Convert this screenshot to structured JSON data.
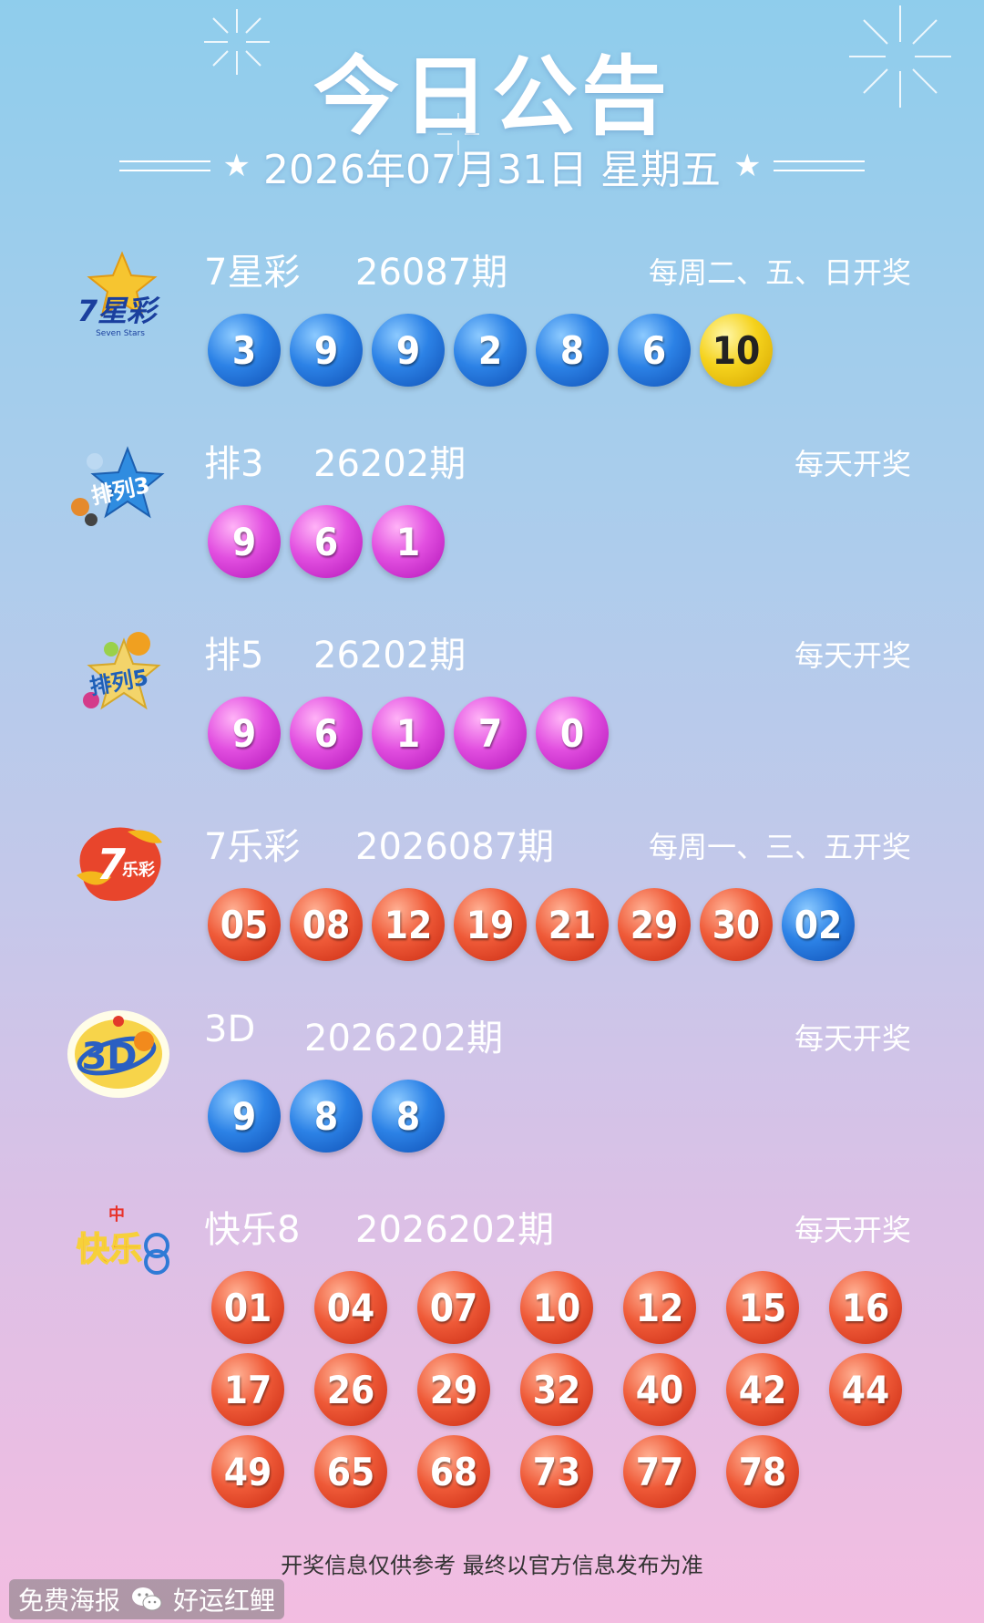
{
  "header": {
    "title": "今日公告",
    "date": "2026年07月31日 星期五"
  },
  "lotteries": [
    {
      "logo_text": "7星彩",
      "name": "7星彩",
      "issue": "26087期",
      "schedule": "每周二、五、日开奖",
      "balls": [
        {
          "n": "3",
          "color": "blue"
        },
        {
          "n": "9",
          "color": "blue"
        },
        {
          "n": "9",
          "color": "blue"
        },
        {
          "n": "2",
          "color": "blue"
        },
        {
          "n": "8",
          "color": "blue"
        },
        {
          "n": "6",
          "color": "blue"
        },
        {
          "n": "10",
          "color": "yellow"
        }
      ]
    },
    {
      "logo_text": "排列3",
      "name": "排3",
      "issue": "26202期",
      "schedule": "每天开奖",
      "balls": [
        {
          "n": "9",
          "color": "pink"
        },
        {
          "n": "6",
          "color": "pink"
        },
        {
          "n": "1",
          "color": "pink"
        }
      ]
    },
    {
      "logo_text": "排列5",
      "name": "排5",
      "issue": "26202期",
      "schedule": "每天开奖",
      "balls": [
        {
          "n": "9",
          "color": "pink"
        },
        {
          "n": "6",
          "color": "pink"
        },
        {
          "n": "1",
          "color": "pink"
        },
        {
          "n": "7",
          "color": "pink"
        },
        {
          "n": "0",
          "color": "pink"
        }
      ]
    },
    {
      "logo_text": "7乐彩",
      "name": "7乐彩",
      "issue": "2026087期",
      "schedule": "每周一、三、五开奖",
      "balls": [
        {
          "n": "05",
          "color": "red"
        },
        {
          "n": "08",
          "color": "red"
        },
        {
          "n": "12",
          "color": "red"
        },
        {
          "n": "19",
          "color": "red"
        },
        {
          "n": "21",
          "color": "red"
        },
        {
          "n": "29",
          "color": "red"
        },
        {
          "n": "30",
          "color": "red"
        },
        {
          "n": "02",
          "color": "blue"
        }
      ]
    },
    {
      "logo_text": "3D",
      "name": "3D",
      "issue": "2026202期",
      "schedule": "每天开奖",
      "balls": [
        {
          "n": "9",
          "color": "blue"
        },
        {
          "n": "8",
          "color": "blue"
        },
        {
          "n": "8",
          "color": "blue"
        }
      ]
    },
    {
      "logo_text": "快乐8",
      "name": "快乐8",
      "issue": "2026202期",
      "schedule": "每天开奖",
      "balls": [
        {
          "n": "01",
          "color": "red"
        },
        {
          "n": "04",
          "color": "red"
        },
        {
          "n": "07",
          "color": "red"
        },
        {
          "n": "10",
          "color": "red"
        },
        {
          "n": "12",
          "color": "red"
        },
        {
          "n": "15",
          "color": "red"
        },
        {
          "n": "16",
          "color": "red"
        },
        {
          "n": "17",
          "color": "red"
        },
        {
          "n": "26",
          "color": "red"
        },
        {
          "n": "29",
          "color": "red"
        },
        {
          "n": "32",
          "color": "red"
        },
        {
          "n": "40",
          "color": "red"
        },
        {
          "n": "42",
          "color": "red"
        },
        {
          "n": "44",
          "color": "red"
        },
        {
          "n": "49",
          "color": "red"
        },
        {
          "n": "65",
          "color": "red"
        },
        {
          "n": "68",
          "color": "red"
        },
        {
          "n": "73",
          "color": "red"
        },
        {
          "n": "77",
          "color": "red"
        },
        {
          "n": "78",
          "color": "red"
        }
      ]
    }
  ],
  "footer": {
    "note": "开奖信息仅供参考 最终以官方信息发布为准",
    "watermark_left": "免费海报",
    "watermark_right": "好运红鲤",
    "watermark_icon": "wechat-icon"
  },
  "colors": {
    "blue": "#2c82e6",
    "yellow": "#f5d21c",
    "pink": "#e24fe0",
    "red": "#ef5a38"
  }
}
